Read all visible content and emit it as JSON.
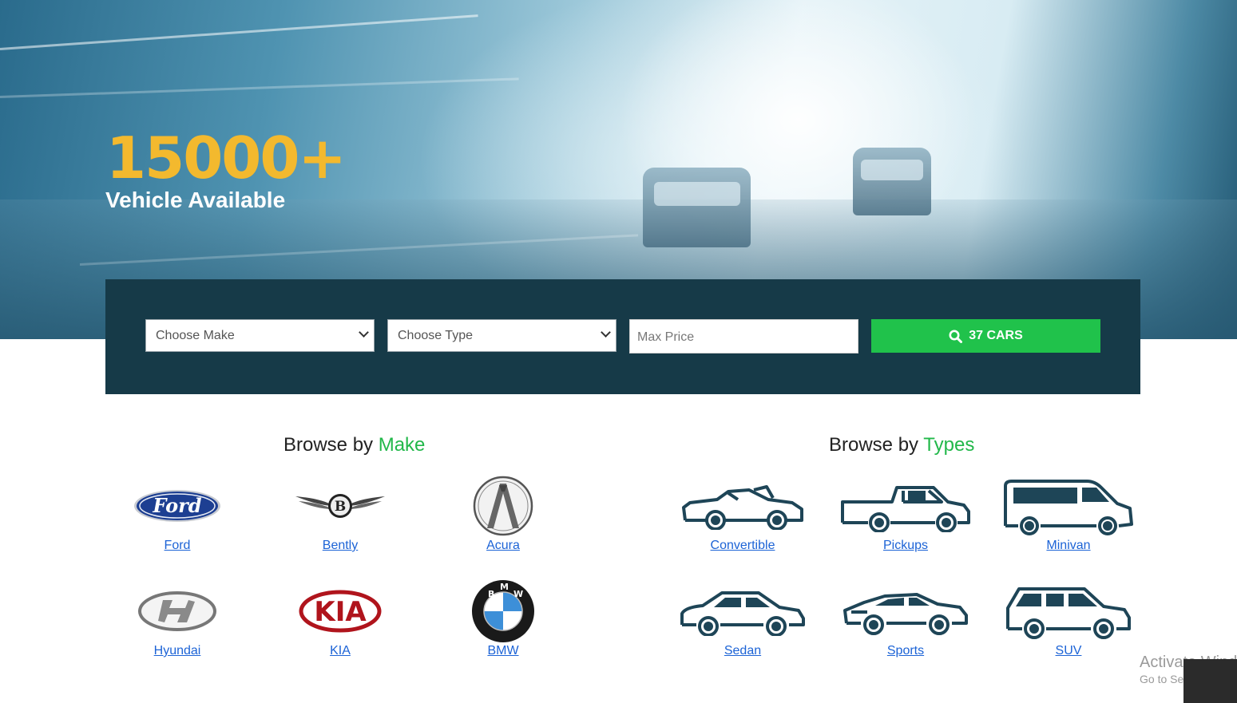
{
  "hero": {
    "headline": "15000+",
    "subline": "Vehicle Available"
  },
  "search": {
    "make_placeholder": "Choose Make",
    "type_placeholder": "Choose Type",
    "price_placeholder": "Max Price",
    "button_label": "37 CARS",
    "button_icon": "search-icon"
  },
  "browse_make": {
    "title_prefix": "Browse by",
    "title_accent": "Make",
    "items": [
      {
        "label": "Ford",
        "icon": "ford-logo"
      },
      {
        "label": "Bently",
        "icon": "bentley-logo"
      },
      {
        "label": "Acura",
        "icon": "acura-logo"
      },
      {
        "label": "Hyundai",
        "icon": "hyundai-logo"
      },
      {
        "label": "KIA",
        "icon": "kia-logo"
      },
      {
        "label": "BMW",
        "icon": "bmw-logo"
      }
    ]
  },
  "browse_type": {
    "title_prefix": "Browse by",
    "title_accent": "Types",
    "items": [
      {
        "label": "Convertible",
        "icon": "convertible-icon"
      },
      {
        "label": "Pickups",
        "icon": "pickup-icon"
      },
      {
        "label": "Minivan",
        "icon": "minivan-icon"
      },
      {
        "label": "Sedan",
        "icon": "sedan-icon"
      },
      {
        "label": "Sports",
        "icon": "sports-car-icon"
      },
      {
        "label": "SUV",
        "icon": "suv-icon"
      }
    ]
  },
  "watermark": {
    "line1": "Activate Wind",
    "line2": "Go to Settings to"
  },
  "colors": {
    "accent": "#22b84a",
    "headline": "#f3b92e",
    "panel": "#163a48",
    "button": "#20c24b",
    "link": "#1c63d6",
    "icon": "#1e4557"
  }
}
